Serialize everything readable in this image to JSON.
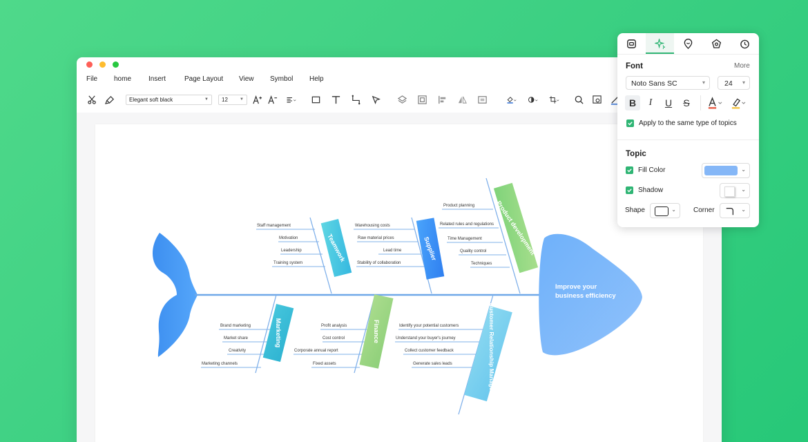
{
  "window": {
    "menu": [
      "File",
      "home",
      "Insert",
      "Page Layout",
      "View",
      "Symbol",
      "Help"
    ]
  },
  "toolbar": {
    "font_family": "Elegant soft black",
    "font_size": "12"
  },
  "diagram": {
    "head": [
      "Improve your",
      "business efficiency"
    ],
    "top_bones": [
      {
        "name": "Teamwork",
        "items": [
          "Staff management",
          "Motivation",
          "Leadership",
          "Training system"
        ]
      },
      {
        "name": "Supplier",
        "items": [
          "Warehousing costs",
          "Raw material prices",
          "Lead time",
          "Stability of collaboration"
        ]
      },
      {
        "name": "Product development",
        "items": [
          "Product planning",
          "Related rules and regulations",
          "Time Management",
          "Quality control",
          "Techniques"
        ]
      }
    ],
    "bottom_bones": [
      {
        "name": "Marketing",
        "items": [
          "Brand marketing",
          "Market share",
          "Creativity",
          "Marketing channels"
        ]
      },
      {
        "name": "Finance",
        "items": [
          "Profit analysis",
          "Cost control",
          "Corporate annual report",
          "Fixed assets"
        ]
      },
      {
        "name": "Customer Relationship Management",
        "items": [
          "Identify your potential customers",
          "Understand your buyer's journey",
          "Collect customer feedback",
          "Generate sales leads"
        ]
      }
    ]
  },
  "panel": {
    "font_section": "Font",
    "more": "More",
    "font_family": "Noto Sans SC",
    "font_size": "24",
    "apply_same": "Apply to the same type of topics",
    "topic_section": "Topic",
    "fill_color_label": "Fill Color",
    "fill_color": "#85b7f7",
    "shadow_label": "Shadow",
    "shape_label": "Shape",
    "corner_label": "Corner"
  }
}
